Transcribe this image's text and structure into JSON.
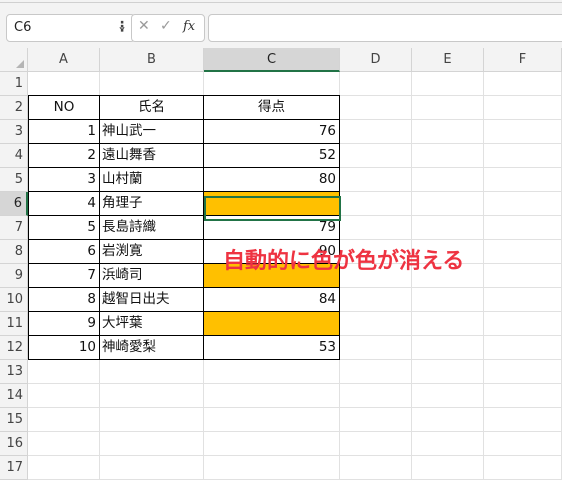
{
  "name_box": {
    "value": "C6"
  },
  "formula_bar": {
    "fx": "fx",
    "cancel": "✕",
    "enter": "✓",
    "content": ""
  },
  "columns": [
    "A",
    "B",
    "C",
    "D",
    "E",
    "F"
  ],
  "rows": [
    "1",
    "2",
    "3",
    "4",
    "5",
    "6",
    "7",
    "8",
    "9",
    "10",
    "11",
    "12",
    "13",
    "14",
    "15",
    "16",
    "17"
  ],
  "table": {
    "headers": {
      "no": "NO",
      "name": "氏名",
      "score": "得点"
    },
    "records": [
      {
        "no": "1",
        "name": "神山武一",
        "score": "76",
        "highlight": false
      },
      {
        "no": "2",
        "name": "遠山舞香",
        "score": "52",
        "highlight": false
      },
      {
        "no": "3",
        "name": "山村蘭",
        "score": "80",
        "highlight": false
      },
      {
        "no": "4",
        "name": "角理子",
        "score": "",
        "highlight": true
      },
      {
        "no": "5",
        "name": "長島詩織",
        "score": "79",
        "highlight": false
      },
      {
        "no": "6",
        "name": "岩渕寛",
        "score": "90",
        "highlight": false
      },
      {
        "no": "7",
        "name": "浜崎司",
        "score": "",
        "highlight": true
      },
      {
        "no": "8",
        "name": "越智日出夫",
        "score": "84",
        "highlight": false
      },
      {
        "no": "9",
        "name": "大坪葉",
        "score": "",
        "highlight": true
      },
      {
        "no": "10",
        "name": "神崎愛梨",
        "score": "53",
        "highlight": false
      }
    ]
  },
  "annotation": "自動的に色が色が消える",
  "colors": {
    "highlight": "#ffc000",
    "annotation": "#ee3341",
    "selection": "#217346"
  }
}
